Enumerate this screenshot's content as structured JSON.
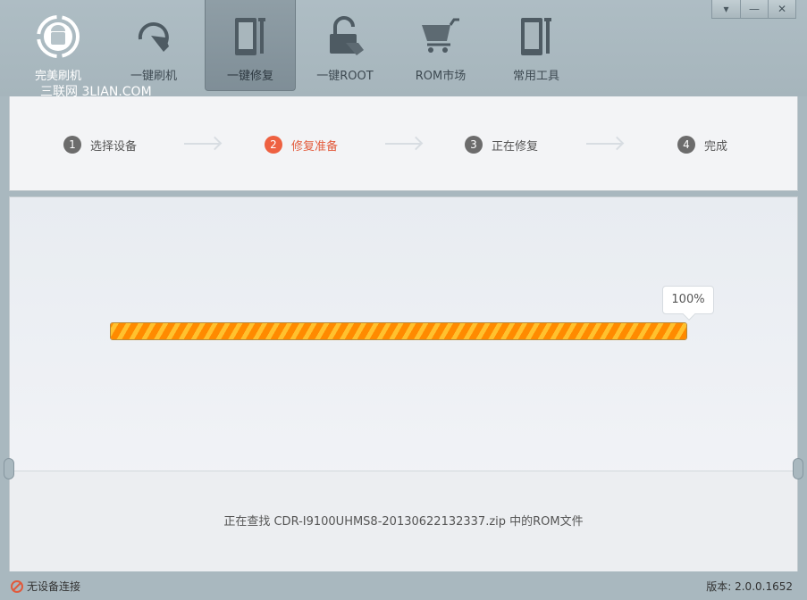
{
  "nav": [
    {
      "label": "完美刷机",
      "icon": "android-flash-icon"
    },
    {
      "label": "一键刷机",
      "icon": "refresh-hand-icon"
    },
    {
      "label": "一键修复",
      "icon": "phone-wrench-icon",
      "active": true
    },
    {
      "label": "一键ROOT",
      "icon": "lock-hand-icon"
    },
    {
      "label": "ROM市场",
      "icon": "cart-icon"
    },
    {
      "label": "常用工具",
      "icon": "tools-icon"
    }
  ],
  "watermark": "三联网 3LIAN.COM",
  "window_buttons": {
    "menu": "▾",
    "minimize": "—",
    "close": "✕"
  },
  "steps": [
    {
      "num": "1",
      "label": "选择设备"
    },
    {
      "num": "2",
      "label": "修复准备",
      "active": true
    },
    {
      "num": "3",
      "label": "正在修复"
    },
    {
      "num": "4",
      "label": "完成"
    }
  ],
  "progress": {
    "percent": 100,
    "label": "100%"
  },
  "message": "正在查找 CDR-I9100UHMS8-20130622132337.zip 中的ROM文件",
  "status": {
    "device": "无设备连接",
    "version": "版本: 2.0.0.1652"
  },
  "colors": {
    "accent": "#ee6141",
    "progress": "#ff8a00"
  }
}
